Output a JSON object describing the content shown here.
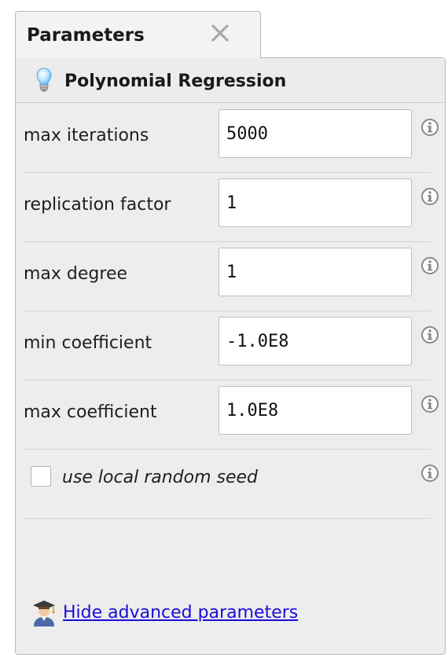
{
  "tab": {
    "title": "Parameters",
    "close_icon": "close-icon"
  },
  "operator": {
    "icon": "lightbulb-icon",
    "name": "Polynomial Regression"
  },
  "parameters": [
    {
      "label": "max iterations",
      "value": "5000",
      "info_icon": "info-icon"
    },
    {
      "label": "replication factor",
      "value": "1",
      "info_icon": "info-icon"
    },
    {
      "label": "max degree",
      "value": "1",
      "info_icon": "info-icon"
    },
    {
      "label": "min coefficient",
      "value": "-1.0E8",
      "info_icon": "info-icon"
    },
    {
      "label": "max coefficient",
      "value": "1.0E8",
      "info_icon": "info-icon"
    }
  ],
  "checkbox": {
    "label": "use local random seed",
    "checked": false,
    "info_icon": "info-icon"
  },
  "footer": {
    "icon": "student-icon",
    "link_label": "Hide advanced parameters",
    "link_color": "#1a0dd6"
  }
}
